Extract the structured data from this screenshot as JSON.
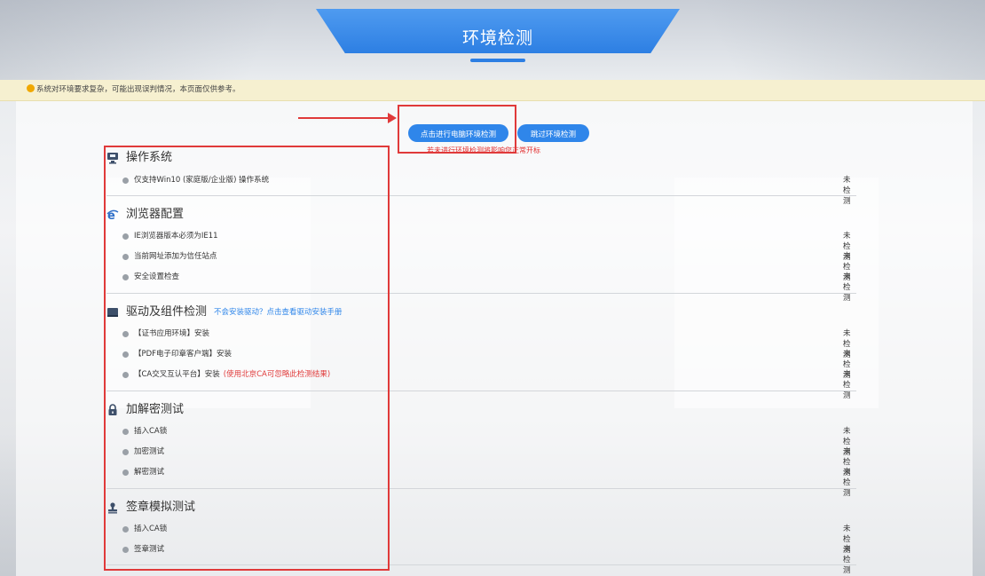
{
  "header": {
    "title": "环境检测"
  },
  "notice": {
    "text": "系统对环境要求复杂，可能出现误判情况，本页面仅供参考。"
  },
  "actions": {
    "check_label": "点击进行电脑环境检测",
    "skip_label": "跳过环境检测",
    "hint": "若未进行环境检测将影响您正常开标"
  },
  "sections": [
    {
      "title": "操作系统",
      "icon": "monitor-icon",
      "items": [
        {
          "label": "仅支持Win10 (家庭版/企业版) 操作系统",
          "status": "未检测"
        }
      ]
    },
    {
      "title": "浏览器配置",
      "icon": "ie-browser-icon",
      "items": [
        {
          "label": "IE浏览器版本必须为IE11",
          "status": "未检测"
        },
        {
          "label": "当前网址添加为信任站点",
          "status": "未检测"
        },
        {
          "label": "安全设置检查",
          "status": "未检测"
        }
      ]
    },
    {
      "title": "驱动及组件检测",
      "icon": "package-icon",
      "link": "不会安装驱动？点击查看驱动安装手册",
      "items": [
        {
          "label": "【证书应用环境】安装",
          "status": "未检测"
        },
        {
          "label": "【PDF电子印章客户端】安装",
          "status": "未检测"
        },
        {
          "label": "【CA交叉互认平台】安装",
          "note": "(使用北京CA可忽略此检测结果)",
          "status": "未检测"
        }
      ]
    },
    {
      "title": "加解密测试",
      "icon": "lock-icon",
      "items": [
        {
          "label": "插入CA锁",
          "status": "未检测"
        },
        {
          "label": "加密测试",
          "status": "未检测"
        },
        {
          "label": "解密测试",
          "status": "未检测"
        }
      ]
    },
    {
      "title": "签章模拟测试",
      "icon": "stamp-icon",
      "items": [
        {
          "label": "插入CA锁",
          "status": "未检测"
        },
        {
          "label": "签章测试",
          "status": "未检测"
        }
      ]
    }
  ]
}
